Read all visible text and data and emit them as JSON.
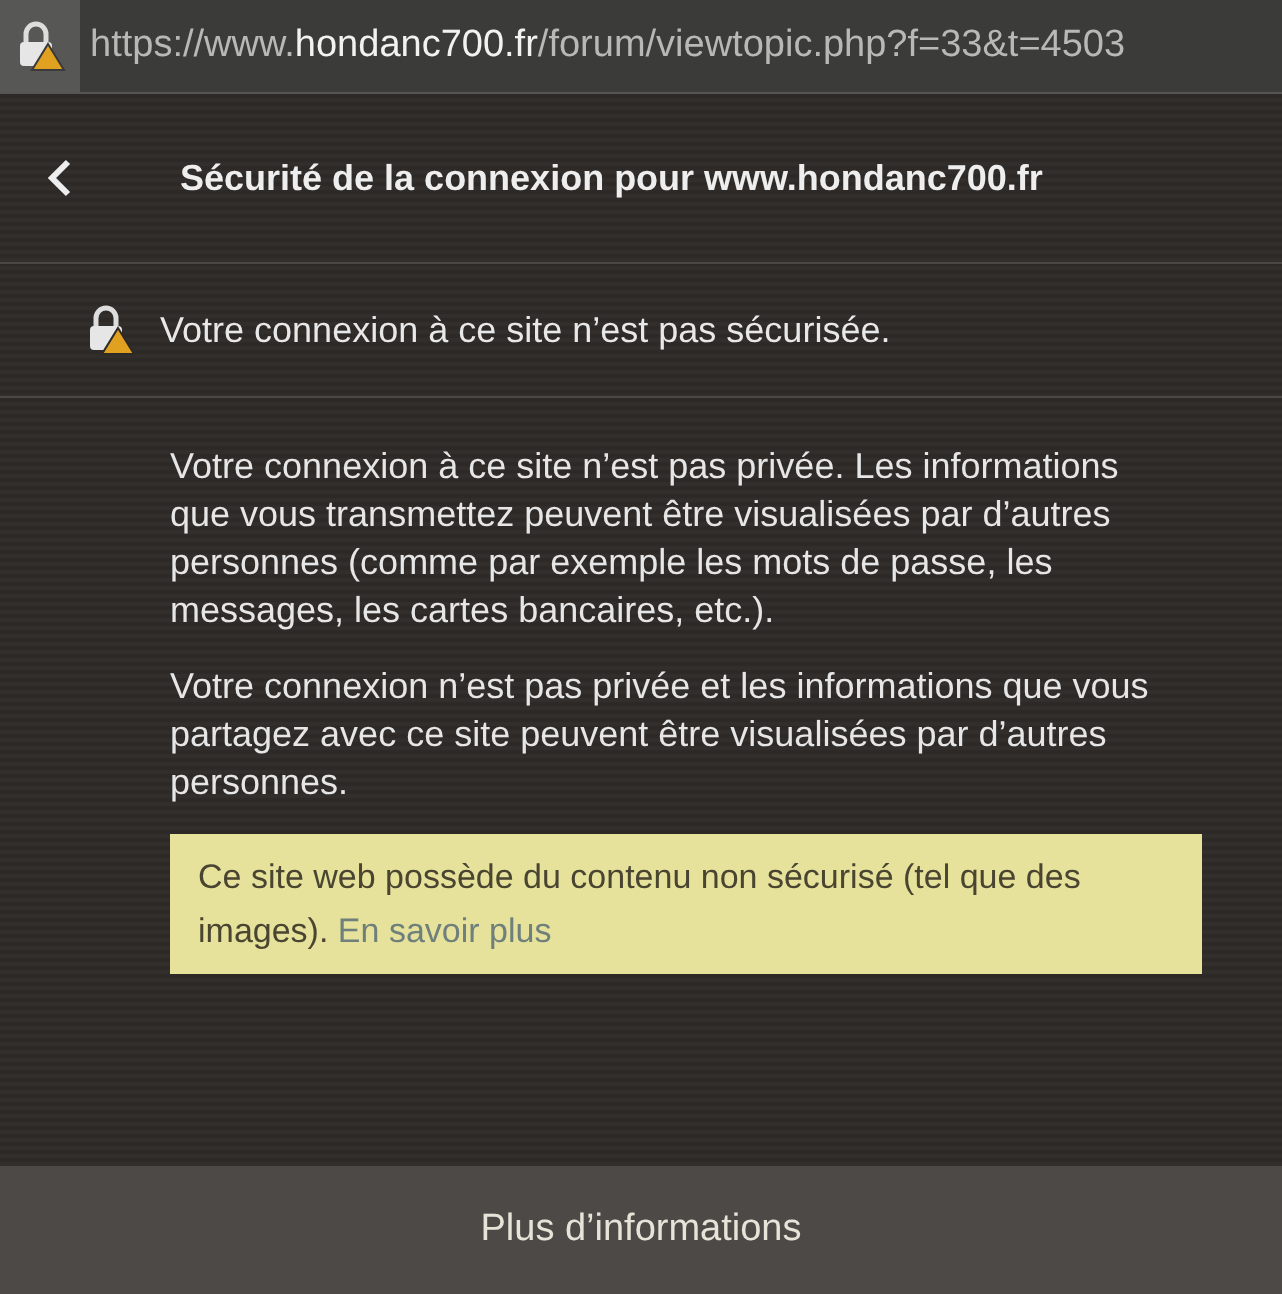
{
  "address_bar": {
    "url": "https://www.**hondanc700.fr**/forum/viewtopic.php?f=33&t=4503",
    "secure": false
  },
  "panel": {
    "title": "Sécurité de la connexion pour www.hondanc700.fr",
    "status": "Votre connexion à ce site n’est pas sécurisée.",
    "paragraphs": [
      "Votre connexion à ce site n’est pas privée. Les informations que vous transmettez peuvent être visualisées par d’autres personnes (comme par exemple les mots de passe, les messages, les cartes bancaires, etc.).",
      "Votre connexion n’est pas privée et les informations que vous partagez avec ce site peuvent être visualisées par d’autres personnes."
    ],
    "warning": {
      "text": "Ce site web possède du contenu non sécurisé (tel que des images).",
      "link": "En savoir plus"
    },
    "footer_button": "Plus d’informations"
  }
}
